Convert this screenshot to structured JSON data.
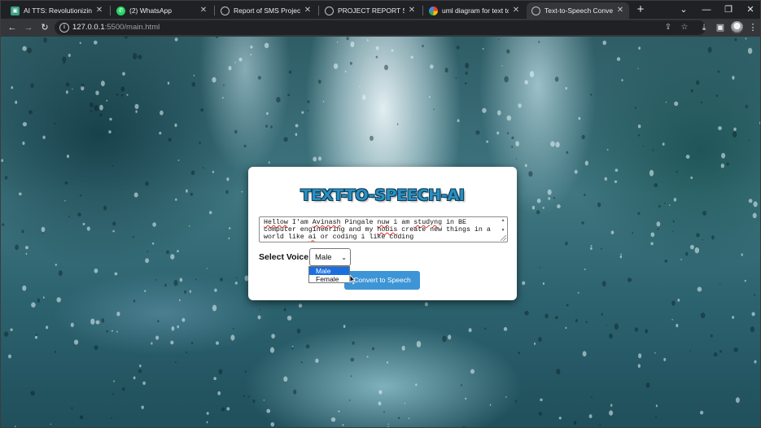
{
  "browser": {
    "tabs": [
      {
        "title": "AI TTS: Revolutionizing Dig",
        "favicon": "ai-tts-favicon",
        "active": false
      },
      {
        "title": "(2) WhatsApp",
        "favicon": "whatsapp-icon",
        "active": false
      },
      {
        "title": "Report of SMS Project.pdf",
        "favicon": "globe-icon",
        "active": false
      },
      {
        "title": "PROJECT REPORT SAMPLE",
        "favicon": "globe-icon",
        "active": false
      },
      {
        "title": "uml diagram for text to sp",
        "favicon": "google-icon",
        "active": false
      },
      {
        "title": "Text-to-Speech Converter",
        "favicon": "globe-icon",
        "active": true
      }
    ],
    "url_host": "127.0.0.1",
    "url_rest": ":5500/main.html"
  },
  "app": {
    "title": "TEXT-TO-SPEECH-AI",
    "text_input": {
      "segments": [
        {
          "t": "Hellow",
          "sq": true
        },
        {
          "t": " I'am ",
          "sq": false
        },
        {
          "t": "Avinash",
          "sq": true
        },
        {
          "t": " Pingale ",
          "sq": false
        },
        {
          "t": "nuw",
          "sq": true
        },
        {
          "t": " i am ",
          "sq": false
        },
        {
          "t": "studyng",
          "sq": true
        },
        {
          "t": " in BE computer engineering and my ",
          "sq": false
        },
        {
          "t": "hobis",
          "sq": true
        },
        {
          "t": " create new things in a world like ",
          "sq": false
        },
        {
          "t": "ai",
          "sq": true
        },
        {
          "t": " or coding i like coding",
          "sq": false
        }
      ]
    },
    "voice_label": "Select Voice:",
    "voice_selected": "Male",
    "voice_options": [
      "Male",
      "Female"
    ],
    "convert_button": "Convert to Speech"
  },
  "colors": {
    "title_fill": "#2a8fc0",
    "button": "#3d95d6",
    "option_highlight": "#1a6fe0"
  }
}
